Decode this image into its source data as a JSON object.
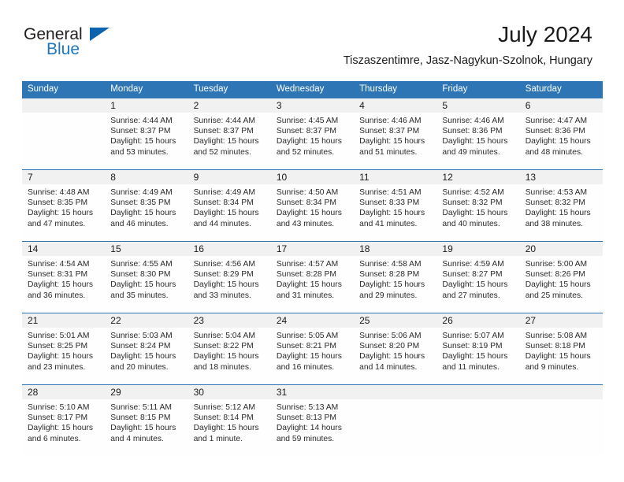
{
  "brand": {
    "name_part1": "General",
    "name_part2": "Blue",
    "triangle_icon": "triangle-icon",
    "color_dark": "#231f20",
    "color_blue": "#1d78c1"
  },
  "header": {
    "title": "July 2024",
    "subtitle": "Tiszaszentimre, Jasz-Nagykun-Szolnok, Hungary"
  },
  "theme": {
    "header_bg": "#2e75b6",
    "daynum_bg": "#f1f1f1",
    "divider": "#2e75b6",
    "text": "#1a1a1a"
  },
  "calendar": {
    "weekdays": [
      "Sunday",
      "Monday",
      "Tuesday",
      "Wednesday",
      "Thursday",
      "Friday",
      "Saturday"
    ],
    "weeks": [
      [
        {
          "day": "",
          "sunrise": "",
          "sunset": "",
          "daylight1": "",
          "daylight2": ""
        },
        {
          "day": "1",
          "sunrise": "Sunrise: 4:44 AM",
          "sunset": "Sunset: 8:37 PM",
          "daylight1": "Daylight: 15 hours",
          "daylight2": "and 53 minutes."
        },
        {
          "day": "2",
          "sunrise": "Sunrise: 4:44 AM",
          "sunset": "Sunset: 8:37 PM",
          "daylight1": "Daylight: 15 hours",
          "daylight2": "and 52 minutes."
        },
        {
          "day": "3",
          "sunrise": "Sunrise: 4:45 AM",
          "sunset": "Sunset: 8:37 PM",
          "daylight1": "Daylight: 15 hours",
          "daylight2": "and 52 minutes."
        },
        {
          "day": "4",
          "sunrise": "Sunrise: 4:46 AM",
          "sunset": "Sunset: 8:37 PM",
          "daylight1": "Daylight: 15 hours",
          "daylight2": "and 51 minutes."
        },
        {
          "day": "5",
          "sunrise": "Sunrise: 4:46 AM",
          "sunset": "Sunset: 8:36 PM",
          "daylight1": "Daylight: 15 hours",
          "daylight2": "and 49 minutes."
        },
        {
          "day": "6",
          "sunrise": "Sunrise: 4:47 AM",
          "sunset": "Sunset: 8:36 PM",
          "daylight1": "Daylight: 15 hours",
          "daylight2": "and 48 minutes."
        }
      ],
      [
        {
          "day": "7",
          "sunrise": "Sunrise: 4:48 AM",
          "sunset": "Sunset: 8:35 PM",
          "daylight1": "Daylight: 15 hours",
          "daylight2": "and 47 minutes."
        },
        {
          "day": "8",
          "sunrise": "Sunrise: 4:49 AM",
          "sunset": "Sunset: 8:35 PM",
          "daylight1": "Daylight: 15 hours",
          "daylight2": "and 46 minutes."
        },
        {
          "day": "9",
          "sunrise": "Sunrise: 4:49 AM",
          "sunset": "Sunset: 8:34 PM",
          "daylight1": "Daylight: 15 hours",
          "daylight2": "and 44 minutes."
        },
        {
          "day": "10",
          "sunrise": "Sunrise: 4:50 AM",
          "sunset": "Sunset: 8:34 PM",
          "daylight1": "Daylight: 15 hours",
          "daylight2": "and 43 minutes."
        },
        {
          "day": "11",
          "sunrise": "Sunrise: 4:51 AM",
          "sunset": "Sunset: 8:33 PM",
          "daylight1": "Daylight: 15 hours",
          "daylight2": "and 41 minutes."
        },
        {
          "day": "12",
          "sunrise": "Sunrise: 4:52 AM",
          "sunset": "Sunset: 8:32 PM",
          "daylight1": "Daylight: 15 hours",
          "daylight2": "and 40 minutes."
        },
        {
          "day": "13",
          "sunrise": "Sunrise: 4:53 AM",
          "sunset": "Sunset: 8:32 PM",
          "daylight1": "Daylight: 15 hours",
          "daylight2": "and 38 minutes."
        }
      ],
      [
        {
          "day": "14",
          "sunrise": "Sunrise: 4:54 AM",
          "sunset": "Sunset: 8:31 PM",
          "daylight1": "Daylight: 15 hours",
          "daylight2": "and 36 minutes."
        },
        {
          "day": "15",
          "sunrise": "Sunrise: 4:55 AM",
          "sunset": "Sunset: 8:30 PM",
          "daylight1": "Daylight: 15 hours",
          "daylight2": "and 35 minutes."
        },
        {
          "day": "16",
          "sunrise": "Sunrise: 4:56 AM",
          "sunset": "Sunset: 8:29 PM",
          "daylight1": "Daylight: 15 hours",
          "daylight2": "and 33 minutes."
        },
        {
          "day": "17",
          "sunrise": "Sunrise: 4:57 AM",
          "sunset": "Sunset: 8:28 PM",
          "daylight1": "Daylight: 15 hours",
          "daylight2": "and 31 minutes."
        },
        {
          "day": "18",
          "sunrise": "Sunrise: 4:58 AM",
          "sunset": "Sunset: 8:28 PM",
          "daylight1": "Daylight: 15 hours",
          "daylight2": "and 29 minutes."
        },
        {
          "day": "19",
          "sunrise": "Sunrise: 4:59 AM",
          "sunset": "Sunset: 8:27 PM",
          "daylight1": "Daylight: 15 hours",
          "daylight2": "and 27 minutes."
        },
        {
          "day": "20",
          "sunrise": "Sunrise: 5:00 AM",
          "sunset": "Sunset: 8:26 PM",
          "daylight1": "Daylight: 15 hours",
          "daylight2": "and 25 minutes."
        }
      ],
      [
        {
          "day": "21",
          "sunrise": "Sunrise: 5:01 AM",
          "sunset": "Sunset: 8:25 PM",
          "daylight1": "Daylight: 15 hours",
          "daylight2": "and 23 minutes."
        },
        {
          "day": "22",
          "sunrise": "Sunrise: 5:03 AM",
          "sunset": "Sunset: 8:24 PM",
          "daylight1": "Daylight: 15 hours",
          "daylight2": "and 20 minutes."
        },
        {
          "day": "23",
          "sunrise": "Sunrise: 5:04 AM",
          "sunset": "Sunset: 8:22 PM",
          "daylight1": "Daylight: 15 hours",
          "daylight2": "and 18 minutes."
        },
        {
          "day": "24",
          "sunrise": "Sunrise: 5:05 AM",
          "sunset": "Sunset: 8:21 PM",
          "daylight1": "Daylight: 15 hours",
          "daylight2": "and 16 minutes."
        },
        {
          "day": "25",
          "sunrise": "Sunrise: 5:06 AM",
          "sunset": "Sunset: 8:20 PM",
          "daylight1": "Daylight: 15 hours",
          "daylight2": "and 14 minutes."
        },
        {
          "day": "26",
          "sunrise": "Sunrise: 5:07 AM",
          "sunset": "Sunset: 8:19 PM",
          "daylight1": "Daylight: 15 hours",
          "daylight2": "and 11 minutes."
        },
        {
          "day": "27",
          "sunrise": "Sunrise: 5:08 AM",
          "sunset": "Sunset: 8:18 PM",
          "daylight1": "Daylight: 15 hours",
          "daylight2": "and 9 minutes."
        }
      ],
      [
        {
          "day": "28",
          "sunrise": "Sunrise: 5:10 AM",
          "sunset": "Sunset: 8:17 PM",
          "daylight1": "Daylight: 15 hours",
          "daylight2": "and 6 minutes."
        },
        {
          "day": "29",
          "sunrise": "Sunrise: 5:11 AM",
          "sunset": "Sunset: 8:15 PM",
          "daylight1": "Daylight: 15 hours",
          "daylight2": "and 4 minutes."
        },
        {
          "day": "30",
          "sunrise": "Sunrise: 5:12 AM",
          "sunset": "Sunset: 8:14 PM",
          "daylight1": "Daylight: 15 hours",
          "daylight2": "and 1 minute."
        },
        {
          "day": "31",
          "sunrise": "Sunrise: 5:13 AM",
          "sunset": "Sunset: 8:13 PM",
          "daylight1": "Daylight: 14 hours",
          "daylight2": "and 59 minutes."
        },
        {
          "day": "",
          "sunrise": "",
          "sunset": "",
          "daylight1": "",
          "daylight2": ""
        },
        {
          "day": "",
          "sunrise": "",
          "sunset": "",
          "daylight1": "",
          "daylight2": ""
        },
        {
          "day": "",
          "sunrise": "",
          "sunset": "",
          "daylight1": "",
          "daylight2": ""
        }
      ]
    ]
  }
}
